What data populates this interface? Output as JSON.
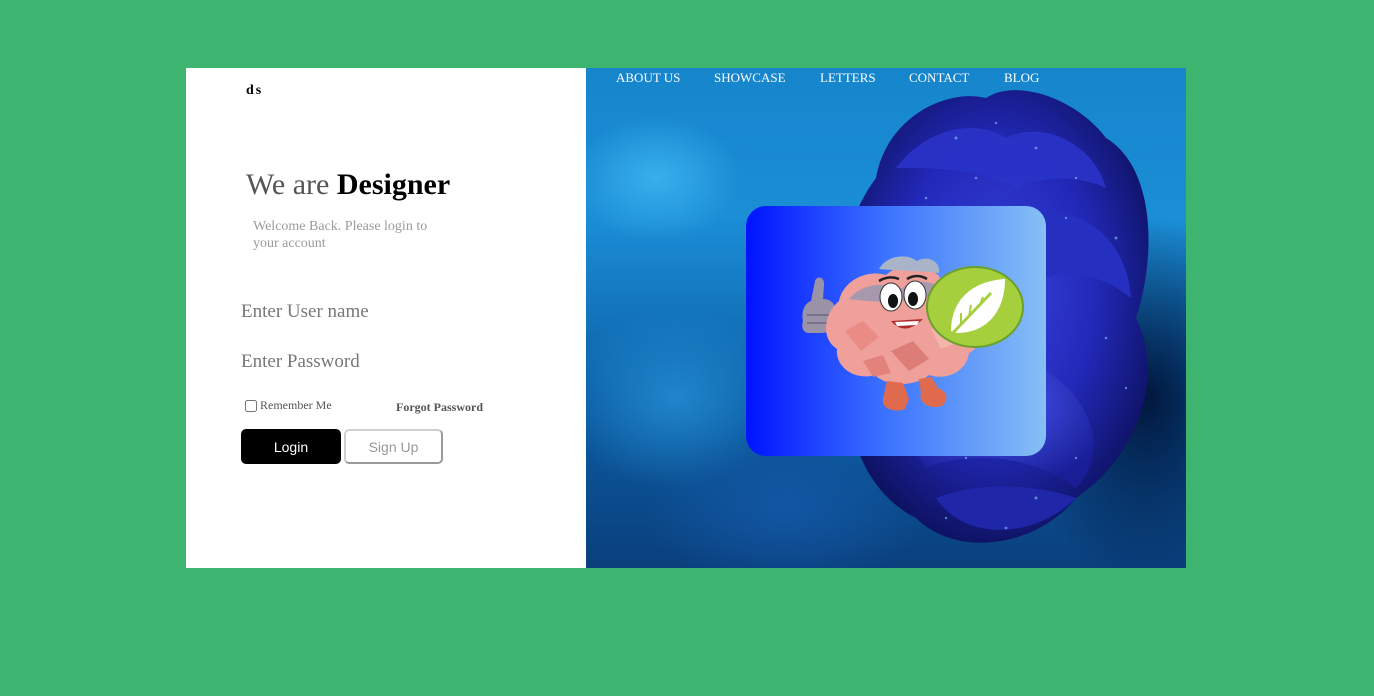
{
  "logo": "ds",
  "headline": {
    "prefix": "We are ",
    "emphasis": "Designer"
  },
  "welcome_text": "Welcome Back. Please login to your account",
  "form": {
    "username_placeholder": "Enter User name",
    "password_placeholder": "Enter Password",
    "remember_label": "Remember Me",
    "remember_checked": false,
    "forgot_label": "Forgot Password",
    "login_label": "Login",
    "signup_label": "Sign Up"
  },
  "nav": {
    "items": [
      {
        "label": "ABOUT US"
      },
      {
        "label": "SHOWCASE"
      },
      {
        "label": "LETTERS"
      },
      {
        "label": "CONTACT"
      },
      {
        "label": "BLOG"
      }
    ]
  },
  "colors": {
    "page_background": "#3db571",
    "card_gradient_start": "#0012ff",
    "card_gradient_end": "#86c0f5",
    "login_button": "#000000"
  },
  "icons": {
    "card_image": "brain-mascot-with-leaf-icon",
    "background_image": "blue-rose-image"
  }
}
